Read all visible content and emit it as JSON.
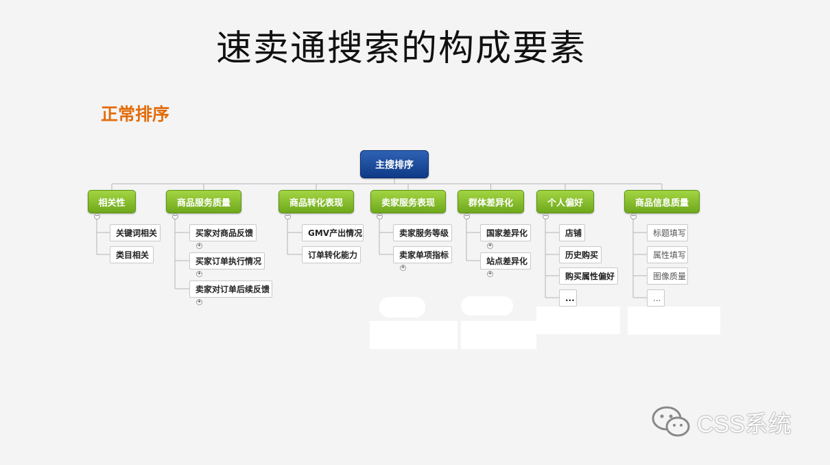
{
  "title": "速卖通搜索的构成要素",
  "subtitle": "正常排序",
  "root": "主搜排序",
  "branches": [
    {
      "label": "相关性",
      "children": [
        "关键词相关",
        "类目相关"
      ]
    },
    {
      "label": "商品服务质量",
      "children": [
        "买家对商品反馈",
        "买家订单执行情况",
        "卖家对订单后续反馈"
      ]
    },
    {
      "label": "商品转化表现",
      "children": [
        "GMV产出情况",
        "订单转化能力"
      ]
    },
    {
      "label": "卖家服务表现",
      "children": [
        "卖家服务等级",
        "卖家单项指标"
      ]
    },
    {
      "label": "群体差异化",
      "children": [
        "国家差异化",
        "站点差异化"
      ]
    },
    {
      "label": "个人偏好",
      "children": [
        "店铺",
        "历史购买",
        "购买属性偏好",
        "..."
      ]
    },
    {
      "label": "商品信息质量",
      "children": [
        "标题填写",
        "属性填写",
        "图像质量",
        "..."
      ]
    }
  ],
  "watermark": "CSS系统",
  "colors": {
    "root": "#1a4b9c",
    "branch": "#8cc133",
    "subtitle": "#e36c0a"
  }
}
